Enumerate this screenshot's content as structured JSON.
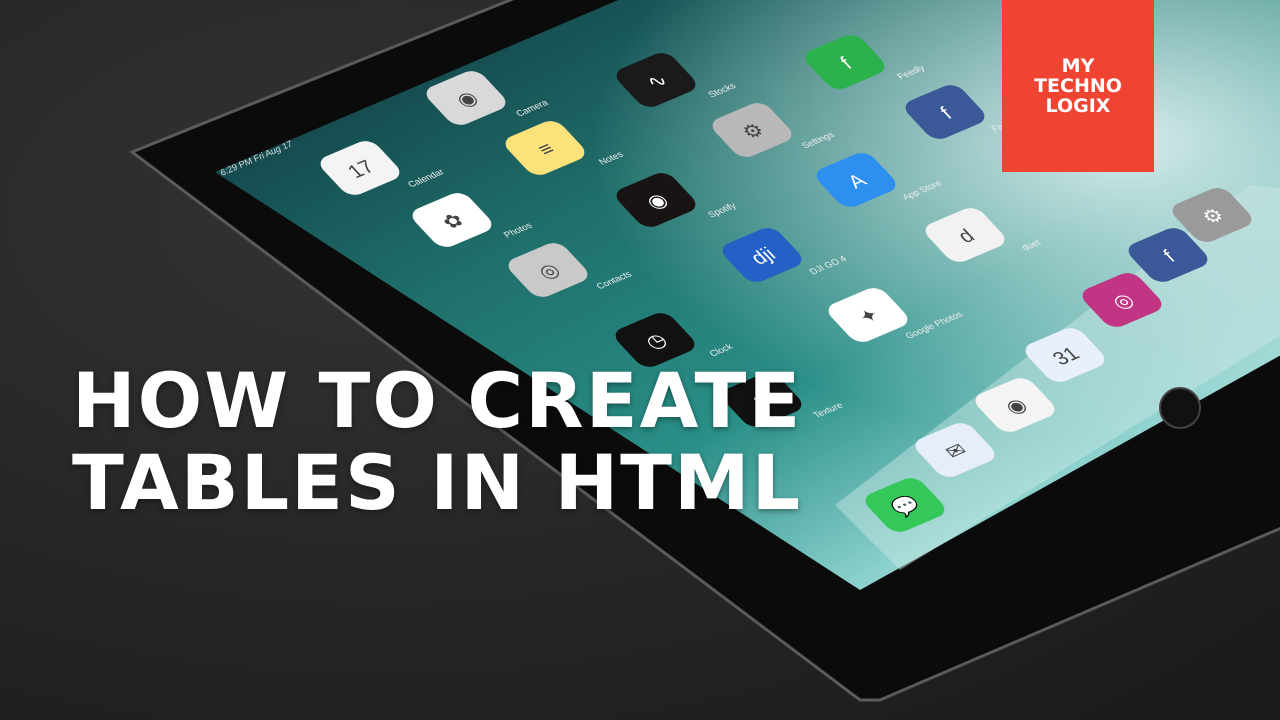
{
  "headline": {
    "line1": "HOW TO CREATE",
    "line2": "TABLES IN HTML"
  },
  "logo": {
    "line1": "MY",
    "line2": "TECHNO",
    "line3": "LOGIX",
    "color": "#f04433"
  },
  "ipad": {
    "status_time": "6:29 PM  Fri Aug 17",
    "apps": [
      {
        "label": "Calendar",
        "color": "#f4f4f4",
        "glyph": "17"
      },
      {
        "label": "Photos",
        "color": "#ffffff",
        "glyph": "✿"
      },
      {
        "label": "Camera",
        "color": "#d9d9d9",
        "glyph": "◉"
      },
      {
        "label": "Notes",
        "color": "#fbe27a",
        "glyph": "≡"
      },
      {
        "label": "Spotify",
        "color": "#191414",
        "glyph": "◉"
      },
      {
        "label": "Contacts",
        "color": "#c9c9c9",
        "glyph": "◎"
      },
      {
        "label": "Clock",
        "color": "#111111",
        "glyph": "◷"
      },
      {
        "label": "Stocks",
        "color": "#1a1a1a",
        "glyph": "∿"
      },
      {
        "label": "Settings",
        "color": "#b8b8b8",
        "glyph": "⚙"
      },
      {
        "label": "App Store",
        "color": "#2d8ff0",
        "glyph": "A"
      },
      {
        "label": "DJI GO 4",
        "color": "#2461c6",
        "glyph": "dji"
      },
      {
        "label": "Google Photos",
        "color": "#ffffff",
        "glyph": "✦"
      },
      {
        "label": "Texture",
        "color": "#111111",
        "glyph": "✕"
      },
      {
        "label": "Feedly",
        "color": "#2bb24c",
        "glyph": "f"
      },
      {
        "label": "Facebook",
        "color": "#3b5998",
        "glyph": "f"
      },
      {
        "label": "duet",
        "color": "#f2f2f2",
        "glyph": "d"
      }
    ],
    "dock": [
      {
        "label": "Messages",
        "color": "#34c759",
        "glyph": "💬"
      },
      {
        "label": "Inbox",
        "color": "#e6eefc",
        "glyph": "✉"
      },
      {
        "label": "Chrome",
        "color": "#f4f4f4",
        "glyph": "◉"
      },
      {
        "label": "Calendar",
        "color": "#e8f0fd",
        "glyph": "31"
      },
      {
        "label": "Instagram",
        "color": "#c13584",
        "glyph": "◎"
      },
      {
        "label": "Facebook",
        "color": "#3b5998",
        "glyph": "f"
      },
      {
        "label": "Settings",
        "color": "#9a9a9a",
        "glyph": "⚙"
      }
    ]
  }
}
